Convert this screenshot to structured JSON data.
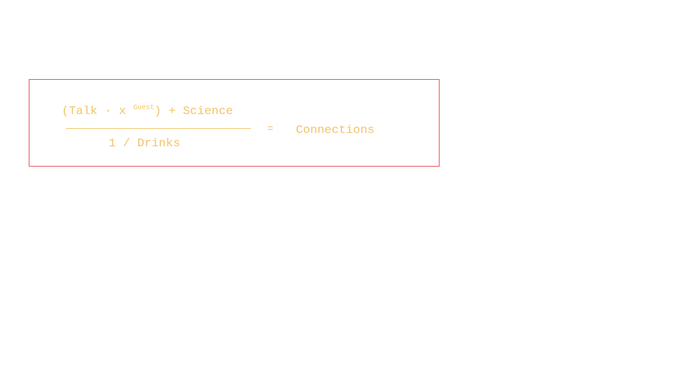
{
  "colors": {
    "box_border": "#e8515b",
    "formula_text": "#f2c46d",
    "background": "#ffffff"
  },
  "formula": {
    "numerator_open": "(Talk",
    "dot": "·",
    "variable": "x",
    "exponent": "Guest",
    "numerator_close": ")",
    "plus": "+",
    "science": "Science",
    "denominator": "1 / Drinks",
    "equals": "=",
    "result": "Connections"
  }
}
